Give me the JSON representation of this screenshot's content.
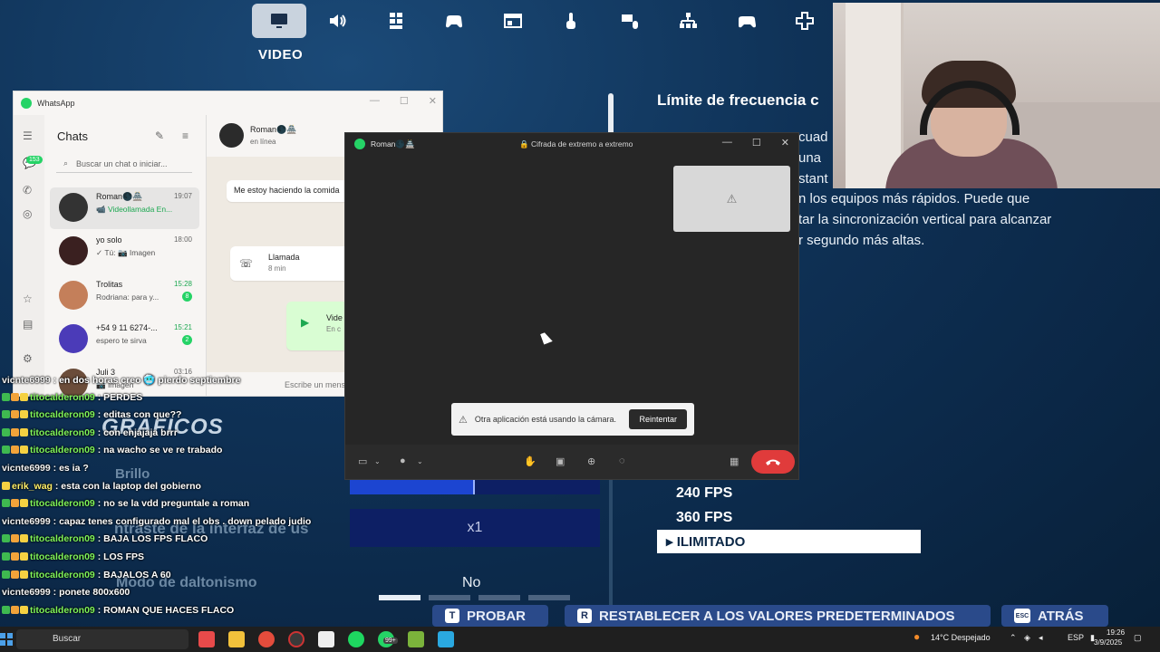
{
  "game": {
    "section_label": "VIDEO",
    "top_icons": [
      "monitor-icon",
      "speaker-icon",
      "grid-icon",
      "controller-icon",
      "layout-icon",
      "pointer-icon",
      "keyboard-mouse-icon",
      "network-icon",
      "gamepad-icon",
      "dpad-icon"
    ],
    "freq_title": "Límite de frecuencia c",
    "desc_fragments": [
      "cuad",
      "una",
      "stant",
      "n los equipos más rápidos. Puede que",
      "tar la sincronización vertical para alcanzar",
      "r segundo más altas."
    ],
    "fps_options": [
      "240 FPS",
      "360 FPS"
    ],
    "fps_selected": "ILIMITADO",
    "graficos": "GRÁFICOS",
    "brillo": "Brillo",
    "contraste": "ntraste de la interfaz de us",
    "daltonismo": "Modo de daltonismo",
    "brightness_fraction": 0.5,
    "scale_value": "x1",
    "toggle_value": "No",
    "bottom_buttons": [
      {
        "key": "T",
        "label": "PROBAR"
      },
      {
        "key": "R",
        "label": "RESTABLECER A LOS VALORES PREDETERMINADOS"
      },
      {
        "key": "ESC",
        "label": "ATRÁS"
      }
    ]
  },
  "whatsapp": {
    "window_title": "WhatsApp",
    "unread_badge": "153",
    "chats_title": "Chats",
    "search_placeholder": "Buscar un chat o iniciar...",
    "chats": [
      {
        "name": "Roman🌑🏯",
        "time": "19:07",
        "preview": "📹 Videollamada En...",
        "unread": ""
      },
      {
        "name": "yo solo",
        "time": "18:00",
        "preview": "✓ Tú: 📷 Imagen",
        "unread": ""
      },
      {
        "name": "Trolitas",
        "time": "15:28",
        "preview": "Rodriana: para y...",
        "unread": "8"
      },
      {
        "name": "+54 9 11 6274-...",
        "time": "15:21",
        "preview": "espero te sirva",
        "unread": "2"
      },
      {
        "name": "Juli 3",
        "time": "03:16",
        "preview": "📷 Imagen",
        "unread": ""
      }
    ],
    "conversation": {
      "name": "Roman🌑🏯",
      "status": "en línea",
      "message": "Me estoy haciendo la comida",
      "call_label": "Llamada",
      "call_duration": "8 min",
      "video_label": "Vide",
      "video_sub": "En c",
      "input_placeholder": "Escribe un mensaje"
    }
  },
  "call": {
    "title": "Roman🌑🏯",
    "e2e": "🔒 Cifrada de extremo a extremo",
    "warning": "Otra aplicación está usando la cámara.",
    "retry": "Reintentar"
  },
  "stream_chat": [
    {
      "user": "vicnte6999",
      "msg": "en dos horas creo 🥶 pierdo septiembre",
      "color": "white",
      "badges": []
    },
    {
      "user": "titocalderon09",
      "msg": "PERDES",
      "color": "green",
      "badges": [
        "#3fb950",
        "#f2a33a",
        "#f5d142"
      ]
    },
    {
      "user": "titocalderon09",
      "msg": "editas con que??",
      "color": "green",
      "badges": [
        "#3fb950",
        "#f2a33a",
        "#f5d142"
      ]
    },
    {
      "user": "titocalderon09",
      "msg": "con enjajaja brrr",
      "color": "green",
      "badges": [
        "#3fb950",
        "#f2a33a",
        "#f5d142"
      ]
    },
    {
      "user": "titocalderon09",
      "msg": "na wacho se ve re trabado",
      "color": "green",
      "badges": [
        "#3fb950",
        "#f2a33a",
        "#f5d142"
      ]
    },
    {
      "user": "vicnte6999",
      "msg": "es ia ?",
      "color": "white",
      "badges": []
    },
    {
      "user": "erik_wag",
      "msg": "esta con la laptop del gobierno",
      "color": "yellow",
      "badges": [
        "#f5d142"
      ]
    },
    {
      "user": "titocalderon09",
      "msg": "no se la vdd preguntale a roman",
      "color": "green",
      "badges": [
        "#3fb950",
        "#f2a33a",
        "#f5d142"
      ]
    },
    {
      "user": "vicnte6999",
      "msg": "capaz tenes configurado mal el obs . down pelado judio",
      "color": "white",
      "badges": []
    },
    {
      "user": "titocalderon09",
      "msg": "BAJA LOS FPS FLACO",
      "color": "green",
      "badges": [
        "#3fb950",
        "#f2a33a",
        "#f5d142"
      ]
    },
    {
      "user": "titocalderon09",
      "msg": "LOS FPS",
      "color": "green",
      "badges": [
        "#3fb950",
        "#f2a33a",
        "#f5d142"
      ]
    },
    {
      "user": "titocalderon09",
      "msg": "BAJALOS A 60",
      "color": "green",
      "badges": [
        "#3fb950",
        "#f2a33a",
        "#f5d142"
      ]
    },
    {
      "user": "vicnte6999",
      "msg": "ponete 800x600",
      "color": "white",
      "badges": []
    },
    {
      "user": "titocalderon09",
      "msg": "ROMAN QUE HACES FLACO",
      "color": "green",
      "badges": [
        "#3fb950",
        "#f2a33a",
        "#f5d142"
      ]
    }
  ],
  "taskbar": {
    "search": "Buscar",
    "notification_count": "99+",
    "weather": "14°C Despejado",
    "lang": "ESP",
    "time": "19:26",
    "date": "3/9/2025"
  },
  "colors": {
    "game_bg": "#0f3257",
    "whatsapp_green": "#25d366",
    "hangup_red": "#e03b3b",
    "slider_fill": "#1c45d1"
  }
}
